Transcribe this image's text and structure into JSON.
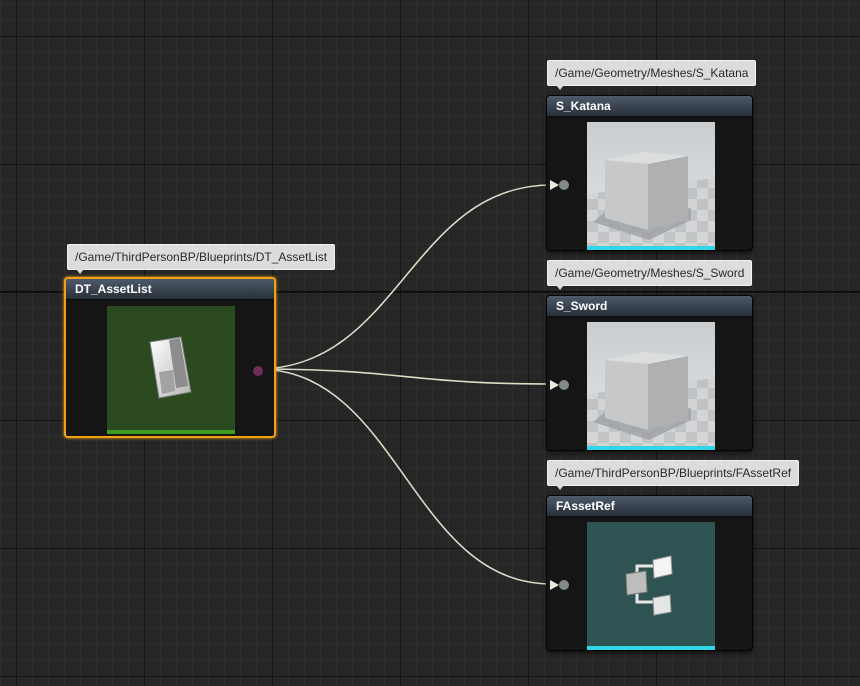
{
  "graph": {
    "wire_color": "#d9dcc6",
    "selection_color": "#f0a116",
    "nodes": [
      {
        "id": "dt_assetlist",
        "title": "DT_AssetList",
        "path": "/Game/ThirdPersonBP/Blueprints/DT_AssetList",
        "thumbnail_icon": "data-table-icon",
        "thumbnail_bg": "#2b4a1f",
        "bar_color": "#3f9e22",
        "selected": true
      },
      {
        "id": "s_katana",
        "title": "S_Katana",
        "path": "/Game/Geometry/Meshes/S_Katana",
        "thumbnail_icon": "static-mesh-cube-icon",
        "bar_color": "#30d5e8"
      },
      {
        "id": "s_sword",
        "title": "S_Sword",
        "path": "/Game/Geometry/Meshes/S_Sword",
        "thumbnail_icon": "static-mesh-cube-icon",
        "bar_color": "#30d5e8"
      },
      {
        "id": "fassetref",
        "title": "FAssetRef",
        "path": "/Game/ThirdPersonBP/Blueprints/FAssetRef",
        "thumbnail_icon": "struct-icon",
        "thumbnail_bg": "#2e5353",
        "bar_color": "#30d5e8"
      }
    ]
  }
}
